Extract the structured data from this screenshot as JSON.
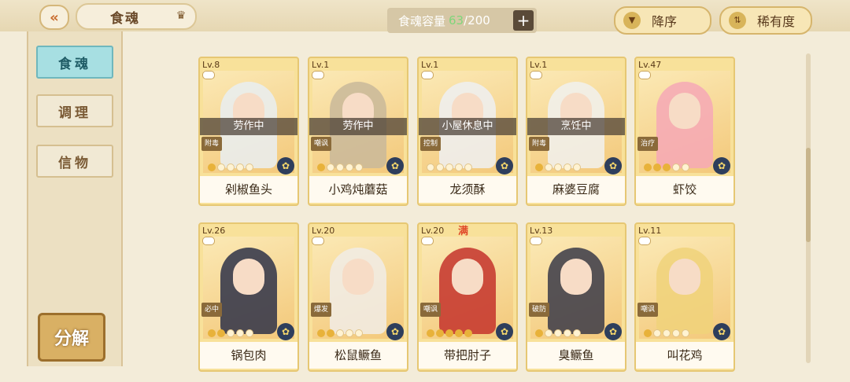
{
  "header": {
    "back_icon": "double-chevron-left-icon",
    "title": "食魂",
    "crown_icon": "crown-icon",
    "capacity_label": "食魂容量",
    "capacity_current": "63",
    "capacity_total": "/200",
    "add_label": "+",
    "sort_order_label": "降序",
    "sort_rarity_label": "稀有度"
  },
  "sidebar": {
    "tabs": [
      {
        "label": "食魂",
        "active": true
      },
      {
        "label": "调理",
        "active": false
      },
      {
        "label": "信物",
        "active": false
      }
    ],
    "decompose_label": "分解"
  },
  "cards": [
    {
      "level": "Lv.8",
      "status": "劳作中",
      "role": "附毒",
      "stars_on": 1,
      "stars_total": 5,
      "name": "剁椒鱼头",
      "hair_color": "#e9eef2"
    },
    {
      "level": "Lv.1",
      "status": "劳作中",
      "role": "嘲讽",
      "stars_on": 1,
      "stars_total": 5,
      "name": "小鸡炖蘑菇",
      "hair_color": "#c9b89a"
    },
    {
      "level": "Lv.1",
      "status": "小屋休息中",
      "role": "控制",
      "stars_on": 0,
      "stars_total": 5,
      "name": "龙须酥",
      "hair_color": "#eef0f2"
    },
    {
      "level": "Lv.1",
      "status": "烹饪中",
      "role": "附毒",
      "stars_on": 1,
      "stars_total": 5,
      "name": "麻婆豆腐",
      "hair_color": "#f1f1ee"
    },
    {
      "level": "Lv.47",
      "status": "",
      "role": "治疗",
      "stars_on": 3,
      "stars_total": 5,
      "name": "虾饺",
      "hair_color": "#f6a8b6"
    },
    {
      "level": "Lv.26",
      "status": "",
      "role": "必中",
      "stars_on": 2,
      "stars_total": 5,
      "name": "锅包肉",
      "hair_color": "#2e3148"
    },
    {
      "level": "Lv.20",
      "status": "",
      "role": "爆发",
      "stars_on": 2,
      "stars_total": 5,
      "name": "松鼠鳜鱼",
      "hair_color": "#f1ece6"
    },
    {
      "level": "Lv.20",
      "status": "",
      "role": "嘲讽",
      "stars_on": 5,
      "stars_total": 5,
      "name": "带把肘子",
      "hair_color": "#c4322c",
      "badge": "满"
    },
    {
      "level": "Lv.13",
      "status": "",
      "role": "破防",
      "stars_on": 1,
      "stars_total": 5,
      "name": "臭鳜鱼",
      "hair_color": "#3a3a48"
    },
    {
      "level": "Lv.11",
      "status": "",
      "role": "嘲讽",
      "stars_on": 1,
      "stars_total": 5,
      "name": "叫花鸡",
      "hair_color": "#f0d27a"
    }
  ]
}
